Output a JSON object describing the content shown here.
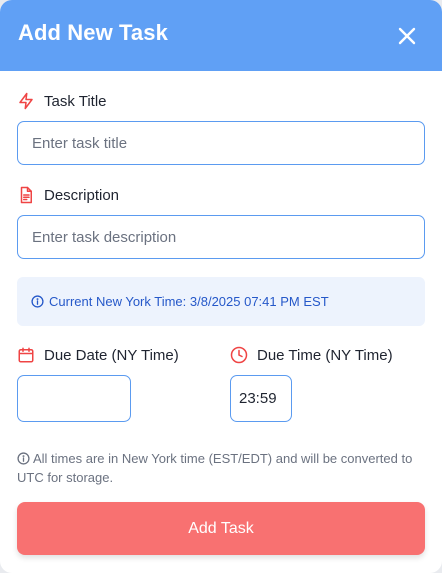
{
  "header": {
    "title": "Add New Task",
    "close_icon": "close-icon"
  },
  "fields": {
    "title": {
      "label": "Task Title",
      "icon": "lightning-icon",
      "placeholder": "Enter task title",
      "value": ""
    },
    "description": {
      "label": "Description",
      "icon": "document-icon",
      "placeholder": "Enter task description",
      "value": ""
    },
    "due_date": {
      "label": "Due Date (NY Time)",
      "icon": "calendar-icon",
      "value": ""
    },
    "due_time": {
      "label": "Due Time (NY Time)",
      "icon": "clock-icon",
      "value": "23:59"
    }
  },
  "info": {
    "icon": "info-icon",
    "text": "Current New York Time: 3/8/2025 07:41 PM EST"
  },
  "note": {
    "icon": "info-icon",
    "text": "All times are in New York time (EST/EDT) and will be converted to UTC for storage."
  },
  "submit": {
    "label": "Add Task"
  },
  "colors": {
    "header": "#60a0f5",
    "accent_red": "#f87171",
    "icon_red": "#ef4444",
    "info_bg": "#edf3fd",
    "info_text": "#2558c9",
    "input_border": "#5b9bf0"
  }
}
